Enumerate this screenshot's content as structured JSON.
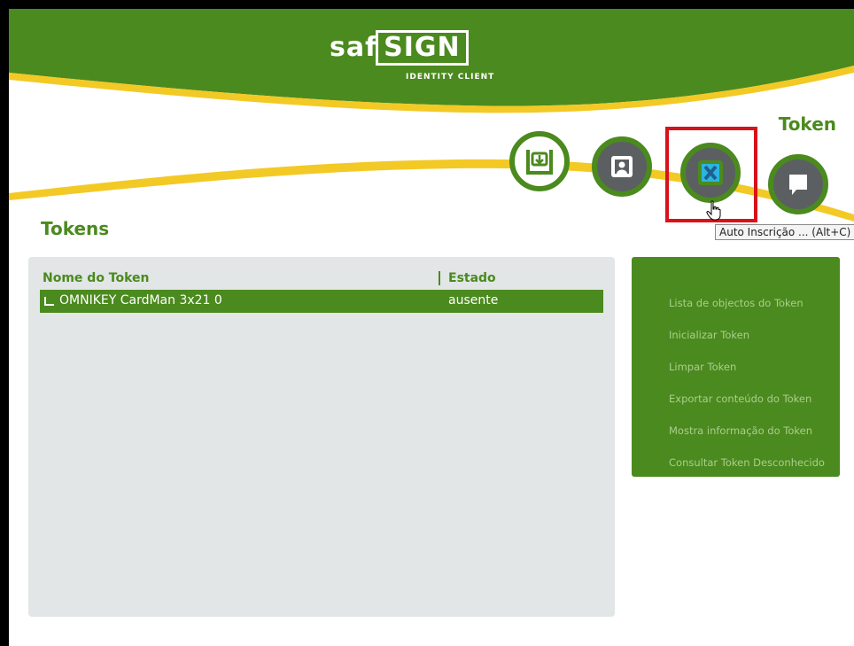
{
  "app": {
    "logo_main": "safesign",
    "logo_left": "saf",
    "logo_box": "SIGN",
    "logo_sub": "IDENTITY CLIENT"
  },
  "header": {
    "section_title": "Token"
  },
  "toolbar": {
    "buttons": [
      {
        "icon": "import-certificate-icon"
      },
      {
        "icon": "digital-id-icon"
      },
      {
        "icon": "auto-enrollment-icon",
        "tooltip": "Auto Inscrição ... (Alt+C)"
      },
      {
        "icon": "message-icon"
      }
    ]
  },
  "tokens": {
    "title": "Tokens",
    "columns": [
      "Nome do Token",
      "Estado"
    ],
    "rows": [
      {
        "name": "OMNIKEY CardMan 3x21 0",
        "state": "ausente"
      }
    ]
  },
  "menu": {
    "items": [
      "Lista de objectos do Token",
      "Inicializar Token",
      "Limpar Token",
      "Exportar conteúdo do Token",
      "Mostra informação do Token",
      "Consultar Token Desconhecido"
    ]
  },
  "colors": {
    "brand_green": "#4b8a1e",
    "accent_yellow": "#f3c925",
    "highlight_red": "#d8121a"
  }
}
